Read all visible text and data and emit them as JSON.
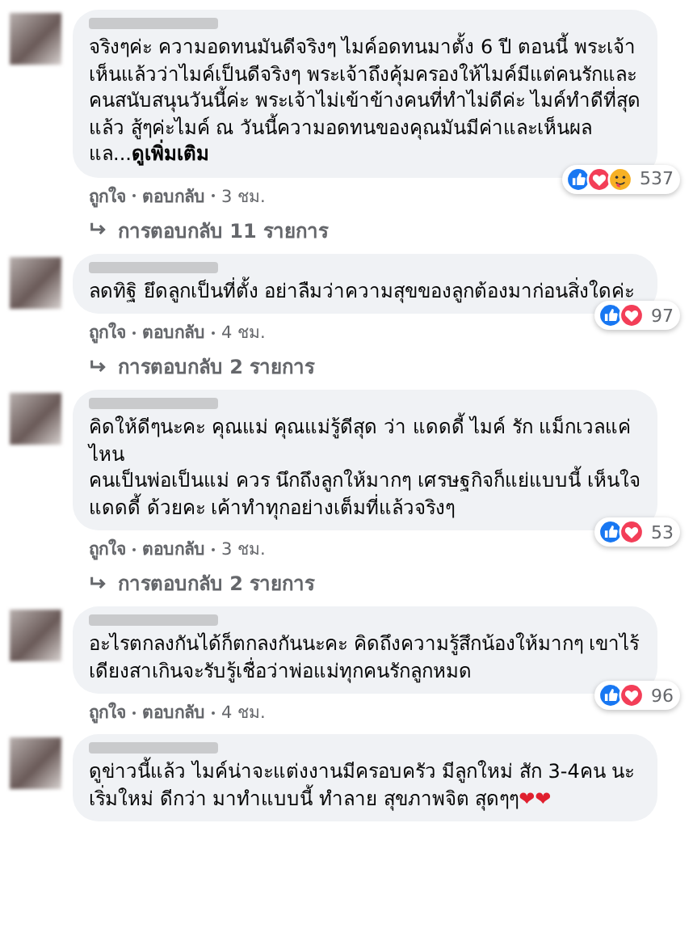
{
  "comments": [
    {
      "text": "จริงๆค่ะ ความอดทนมันดีจริงๆ ไมค์อดทนมาตั้ง 6 ปี ตอนนี้ พระเจ้าเห็นแล้วว่าไมค์เป็นดีจริงๆ พระเจ้าถึงคุ้มครองให้ไมค์มีแต่คนรักและคนสนับสนุนวันนี้ค่ะ พระเจ้าไม่เข้าข้างคนที่ทำไม่ดีค่ะ ไมค์ทำดีที่สุดแล้ว สู้ๆค่ะไมค์ ณ วันนี้ความอดทนของคุณมันมีค่าและเห็นผลแล...",
      "more": "ดูเพิ่มเติม",
      "reactions": [
        {
          "kind": "like"
        },
        {
          "kind": "love"
        },
        {
          "kind": "care"
        }
      ],
      "count": "537",
      "like": "ถูกใจ",
      "reply": "ตอบกลับ",
      "time": "3 ชม.",
      "replies": "การตอบกลับ 11 รายการ"
    },
    {
      "text": "ลดทิฐิ ยึดลูกเป็นที่ตั้ง อย่าลืมว่าความสุขของลูกต้องมาก่อนสิ่งใดค่ะ",
      "reactions": [
        {
          "kind": "like"
        },
        {
          "kind": "love"
        }
      ],
      "count": "97",
      "like": "ถูกใจ",
      "reply": "ตอบกลับ",
      "time": "4 ชม.",
      "replies": "การตอบกลับ 2 รายการ"
    },
    {
      "text": "คิดให้ดีๆนะคะ คุณแม่ คุณแม่รู้ดีสุด ว่า แดดดี้ ไมค์ รัก แม็กเวลแค่ไหน\nคนเป็นพ่อเป็นแม่ ควร นึกถึงลูกให้มากๆ เศรษฐกิจก็แย่แบบนี้ เห็นใจ แดดดี้ ด้วยคะ เค้าทำทุกอย่างเต็มที่แล้วจริงๆ",
      "reactions": [
        {
          "kind": "like"
        },
        {
          "kind": "love"
        }
      ],
      "count": "53",
      "like": "ถูกใจ",
      "reply": "ตอบกลับ",
      "time": "3 ชม.",
      "replies": "การตอบกลับ 2 รายการ"
    },
    {
      "text": "อะไรตกลงกันได้ก็ตกลงกันนะคะ คิดถึงความรู้สึกน้องให้มากๆ เขาไร้เดียงสาเกินจะรับรู้เชื่อว่าพ่อแม่ทุกคนรักลูกหมด",
      "reactions": [
        {
          "kind": "like"
        },
        {
          "kind": "love"
        }
      ],
      "count": "96",
      "like": "ถูกใจ",
      "reply": "ตอบกลับ",
      "time": "4 ชม."
    },
    {
      "text": "ดูข่าวนี้แล้ว ไมค์น่าจะแต่งงานมีครอบครัว มีลูกใหม่ สัก 3-4คน นะ เริ่มใหม่ ดีกว่า มาทำแบบนี้ ทำลาย สุขภาพจิต สุดๆๆ",
      "emoji": "❤❤"
    }
  ]
}
